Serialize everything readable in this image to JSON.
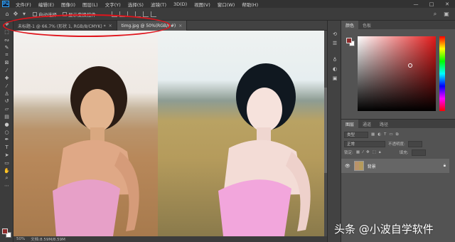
{
  "menubar": {
    "logo": "Ps",
    "items": [
      "文件(F)",
      "编辑(E)",
      "图像(I)",
      "图层(L)",
      "文字(Y)",
      "选择(S)",
      "滤镜(T)",
      "3D(D)",
      "视图(V)",
      "窗口(W)",
      "帮助(H)"
    ],
    "win_min": "—",
    "win_max": "□",
    "win_close": "✕"
  },
  "options": {
    "auto_select": "自动选择",
    "show_transform": "显示变换控件"
  },
  "tabs": [
    {
      "label": "未标题-1 @ 66.7% (形状 1, RGB/8/CMYK) *",
      "close": "×"
    },
    {
      "label": "timg.jpg @ 50%(RGB/8#)",
      "close": "×"
    }
  ],
  "status": {
    "zoom": "50%",
    "doc": "文档:8.59M/8.59M"
  },
  "color_panel": {
    "tab_color": "颜色",
    "tab_swatches": "色板"
  },
  "layers_panel": {
    "tab_layers": "图层",
    "tab_channels": "通道",
    "tab_paths": "路径",
    "kind": "类型",
    "blend_mode": "正常",
    "opacity_label": "不透明度:",
    "lock_label": "锁定:",
    "fill_label": "填充:",
    "layer_name": "背景"
  },
  "watermark": "头条 @小波自学软件",
  "colors": {
    "foreground": "#8e2a2a",
    "background": "#ffffff",
    "annotation": "#e0141c"
  }
}
